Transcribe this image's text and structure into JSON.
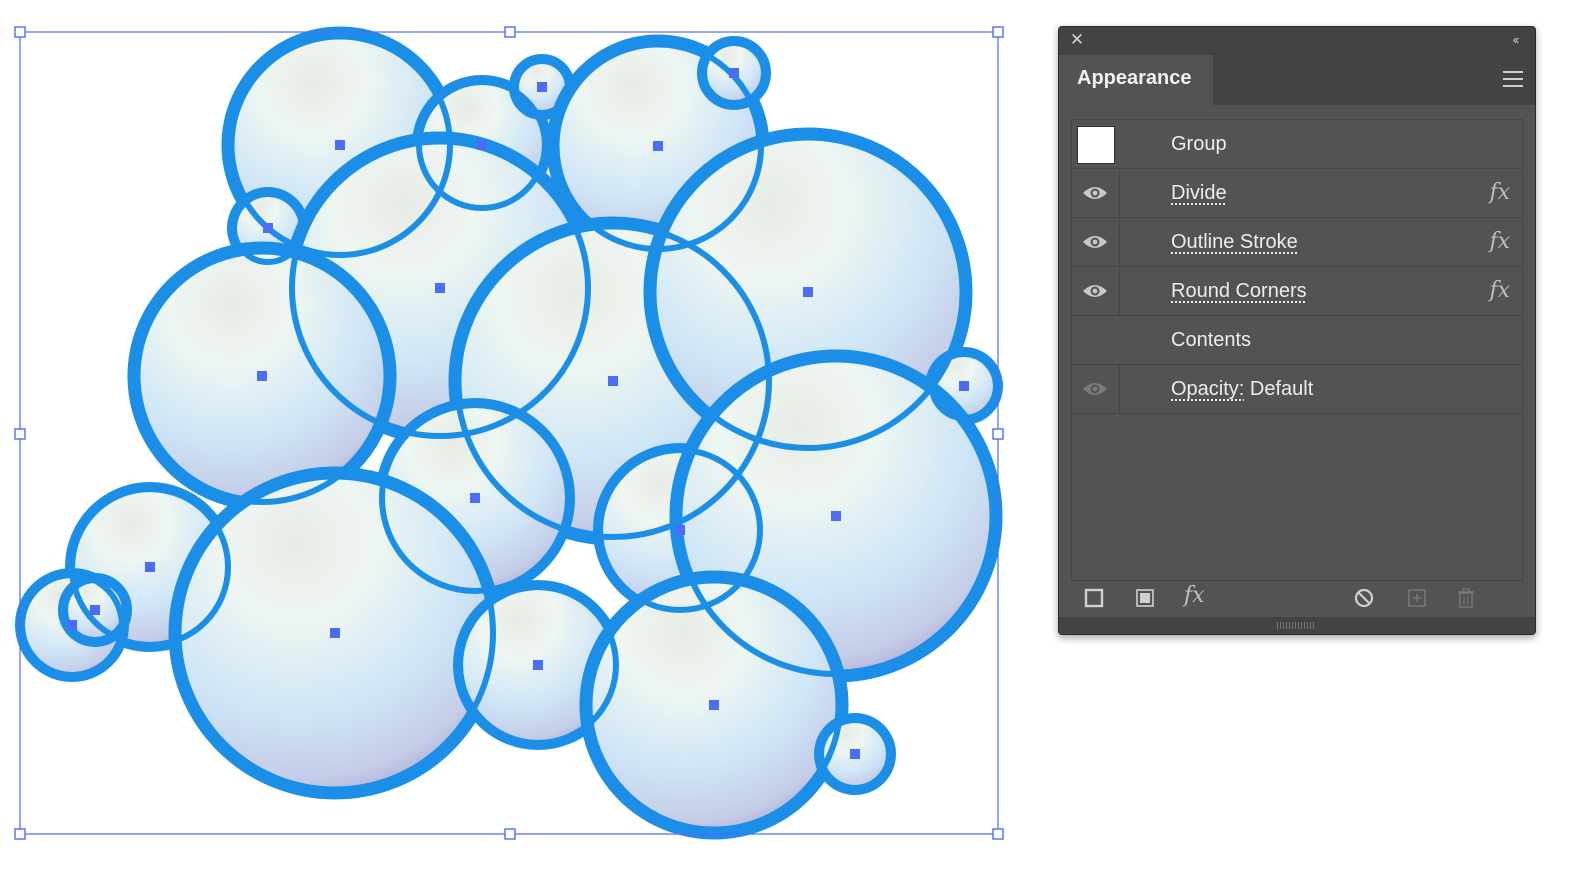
{
  "panel": {
    "tab_label": "Appearance",
    "rows": [
      {
        "label": "Group",
        "has_swatch": true,
        "swatch_color": "#ffffff"
      },
      {
        "label": "Divide",
        "visible": true,
        "fx": true
      },
      {
        "label": "Outline Stroke",
        "visible": true,
        "fx": true
      },
      {
        "label": "Round Corners",
        "visible": true,
        "fx": true
      },
      {
        "label": "Contents"
      },
      {
        "label": "Opacity:",
        "value": "Default",
        "visible": true,
        "dimmed_eye": true
      }
    ],
    "fx_glyph": "fx"
  },
  "icons": {
    "close": "close-icon",
    "collapse": "double-chevron-left-icon",
    "menu": "hamburger-menu-icon",
    "eye": "eye-icon",
    "add_stroke": "add-stroke-icon",
    "add_fill": "add-fill-icon",
    "add_effect": "fx-icon",
    "clear": "no-sign-icon",
    "duplicate": "duplicate-item-icon",
    "delete": "trash-icon"
  },
  "colors": {
    "selection": "#4a6cf7",
    "bubble_stroke": "#1b8fe8",
    "panel_bg": "#535353"
  }
}
